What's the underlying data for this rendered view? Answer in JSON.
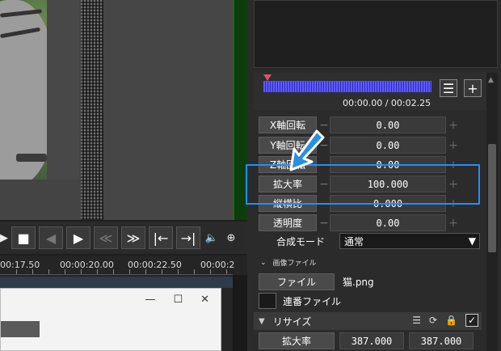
{
  "audio": {
    "time_readout": "00:00.00 / 00:02.25"
  },
  "transport": {
    "icons": [
      "play-icon",
      "stop-icon",
      "prev-frame-icon",
      "next-frame-icon",
      "rewind-icon",
      "fast-forward-icon",
      "jump-start-icon",
      "jump-end-icon",
      "volume-icon",
      "zoom-icon"
    ]
  },
  "timeline": {
    "ruler": [
      "00:17.50",
      "00:00:20.00",
      "00:00:22.50",
      "00:00:2"
    ]
  },
  "dialog": {
    "minimize": "—",
    "maximize": "☐",
    "close": "✕"
  },
  "properties": [
    {
      "label": "X軸回転",
      "value": "0.00"
    },
    {
      "label": "Y軸回転",
      "value": "0.00"
    },
    {
      "label": "Z軸回転",
      "value": "0.00"
    },
    {
      "label": "拡大率",
      "value": "100.000"
    },
    {
      "label": "縦横比",
      "value": "0.000"
    },
    {
      "label": "透明度",
      "value": "0.00"
    }
  ],
  "blend": {
    "label": "合成モード",
    "value": "通常"
  },
  "image_section": {
    "title": "画像ファイル",
    "file_button": "ファイル",
    "file_name": "猫.png",
    "sequence_label": "連番ファイル"
  },
  "resize": {
    "label": "リサイズ",
    "scale_button": "拡大率",
    "scale_x": "387.000",
    "scale_y": "387.000"
  },
  "colors": {
    "highlight": "#1e90ff",
    "arrow": "#2a8fe0",
    "wave": "#5b5bff"
  }
}
